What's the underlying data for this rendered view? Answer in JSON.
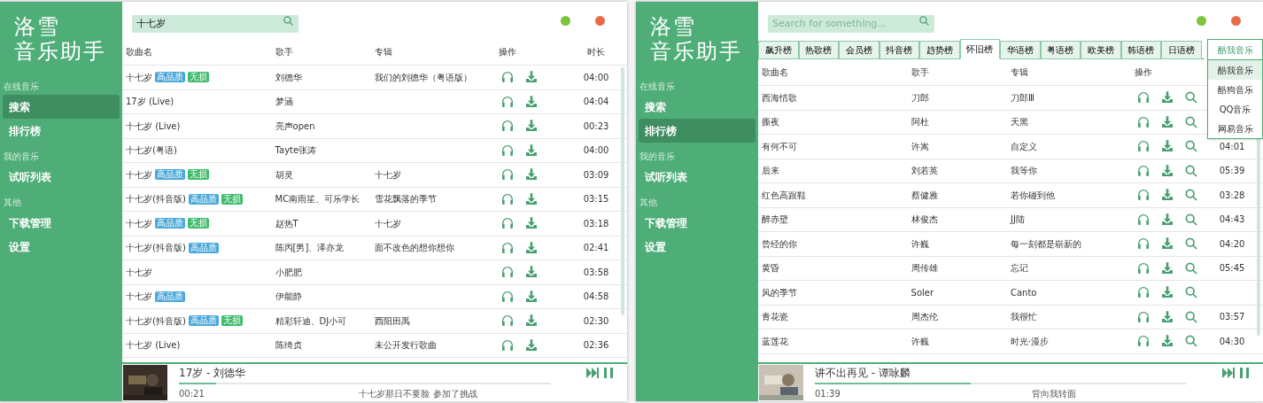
{
  "windows": [
    {
      "logo": [
        "洛雪",
        "音乐助手"
      ],
      "sidebar": [
        {
          "label": "在线音乐",
          "items": [
            {
              "label": "搜索",
              "selected": true
            },
            {
              "label": "排行榜",
              "selected": false
            }
          ]
        },
        {
          "label": "我的音乐",
          "items": [
            {
              "label": "试听列表",
              "selected": false
            }
          ]
        },
        {
          "label": "其他",
          "items": [
            {
              "label": "下载管理",
              "selected": false
            },
            {
              "label": "设置",
              "selected": false
            }
          ]
        }
      ],
      "search": {
        "value": "十七岁"
      },
      "columns": [
        "歌曲名",
        "歌手",
        "专辑",
        "操作",
        "时长"
      ],
      "actions": [
        {
          "kind": "listen"
        },
        {
          "kind": "download"
        }
      ],
      "rows": [
        {
          "song": "十七岁",
          "badges": [
            {
              "kind": "hq",
              "label": "高品质"
            },
            {
              "kind": "lossless",
              "label": "无损"
            }
          ],
          "singer": "刘德华",
          "album": "我们的刘德华（粤语版）",
          "duration": "04:00"
        },
        {
          "song": "17岁 (Live)",
          "singer": "梦涵",
          "duration": "04:04"
        },
        {
          "song": "十七岁 (Live)",
          "singer": "亮声open",
          "duration": "00:23"
        },
        {
          "song": "十七岁(粤语)",
          "singer": "Tayte张涛",
          "duration": "04:00"
        },
        {
          "song": "十七岁",
          "badges": [
            {
              "kind": "hq",
              "label": "高品质"
            },
            {
              "kind": "lossless",
              "label": "无损"
            }
          ],
          "singer": "胡灵",
          "album": "十七岁",
          "duration": "03:09"
        },
        {
          "song": "十七岁(抖音版)",
          "badges": [
            {
              "kind": "hq",
              "label": "高品质"
            },
            {
              "kind": "lossless",
              "label": "无损"
            }
          ],
          "singer": "MC南雨笙、可乐学长",
          "album": "雪花飘落的季节",
          "duration": "03:15"
        },
        {
          "song": "十七岁",
          "badges": [
            {
              "kind": "hq",
              "label": "高品质"
            },
            {
              "kind": "lossless",
              "label": "无损"
            }
          ],
          "singer": "赵热T",
          "album": "十七岁",
          "duration": "03:18"
        },
        {
          "song": "十七岁(抖音版)",
          "badges": [
            {
              "kind": "hq",
              "label": "高品质"
            }
          ],
          "singer": "陈丙[男]、泽亦龙",
          "album": "面不改色的想你想你",
          "duration": "02:41"
        },
        {
          "song": "十七岁",
          "singer": "小肥肥",
          "duration": "03:58"
        },
        {
          "song": "十七岁",
          "badges": [
            {
              "kind": "hq",
              "label": "高品质"
            }
          ],
          "singer": "伊能静",
          "duration": "04:58"
        },
        {
          "song": "十七岁(抖音版)",
          "badges": [
            {
              "kind": "hq",
              "label": "高品质"
            },
            {
              "kind": "lossless",
              "label": "无损"
            }
          ],
          "singer": "精彩轩迪、DJ小可",
          "album": "酉阳田禹",
          "duration": "02:30"
        },
        {
          "song": "十七岁 (Live)",
          "singer": "陈绮贞",
          "album": "未公开发行歌曲",
          "duration": "02:36"
        }
      ],
      "player": {
        "title": "17岁 - 刘德华",
        "time": "00:21",
        "lyric": "十七岁那日不要脸 参加了挑战",
        "level": 0.1
      }
    },
    {
      "logo": [
        "洛雪",
        "音乐助手"
      ],
      "sidebar": [
        {
          "label": "在线音乐",
          "items": [
            {
              "label": "搜索",
              "selected": false
            },
            {
              "label": "排行榜",
              "selected": true
            }
          ]
        },
        {
          "label": "我的音乐",
          "items": [
            {
              "label": "试听列表",
              "selected": false
            }
          ]
        },
        {
          "label": "其他",
          "items": [
            {
              "label": "下载管理",
              "selected": false
            },
            {
              "label": "设置",
              "selected": false
            }
          ]
        }
      ],
      "search": {
        "placeholder": "Search for something..."
      },
      "tabs": [
        {
          "label": "飙升榜",
          "selected": false
        },
        {
          "label": "热歌榜",
          "selected": false
        },
        {
          "label": "会员榜",
          "selected": false
        },
        {
          "label": "抖音榜",
          "selected": false
        },
        {
          "label": "趋势榜",
          "selected": false
        },
        {
          "label": "怀旧榜",
          "selected": true
        },
        {
          "label": "华语榜",
          "selected": false
        },
        {
          "label": "粤语榜",
          "selected": false
        },
        {
          "label": "欧美榜",
          "selected": false
        },
        {
          "label": "韩语榜",
          "selected": false
        },
        {
          "label": "日语榜",
          "selected": false
        }
      ],
      "source_menu": {
        "value": "酷我音乐",
        "options": [
          {
            "label": "酷我音乐",
            "selected": true
          },
          {
            "label": "酷狗音乐",
            "selected": false
          },
          {
            "label": "QQ音乐",
            "selected": false
          },
          {
            "label": "网易音乐",
            "selected": false
          }
        ]
      },
      "columns": [
        "歌曲名",
        "歌手",
        "专辑",
        "操作"
      ],
      "actions": [
        {
          "kind": "listen"
        },
        {
          "kind": "download"
        },
        {
          "kind": "search"
        }
      ],
      "rows": [
        {
          "song": "西海情歌",
          "singer": "刀郎",
          "album": "刀郎Ⅲ"
        },
        {
          "song": "撕夜",
          "singer": "阿杜",
          "album": "天黑"
        },
        {
          "song": "有何不可",
          "singer": "许嵩",
          "album": "自定义",
          "duration": "04:01"
        },
        {
          "song": "后来",
          "singer": "刘若英",
          "album": "我等你",
          "duration": "05:39"
        },
        {
          "song": "红色高跟鞋",
          "singer": "蔡健雅",
          "album": "若你碰到他",
          "duration": "03:28"
        },
        {
          "song": "醉赤壁",
          "singer": "林俊杰",
          "album": "JJ陆",
          "duration": "04:43"
        },
        {
          "song": "曾经的你",
          "singer": "许巍",
          "album": "每一刻都是崭新的",
          "duration": "04:20"
        },
        {
          "song": "黄昏",
          "singer": "周传雄",
          "album": "忘记",
          "duration": "05:45"
        },
        {
          "song": "风的季节",
          "singer": "Soler",
          "album": "Canto"
        },
        {
          "song": "青花瓷",
          "singer": "周杰伦",
          "album": "我很忙",
          "duration": "03:57"
        },
        {
          "song": "蓝莲花",
          "singer": "许巍",
          "album": "时光·漫步",
          "duration": "04:30"
        }
      ],
      "player": {
        "title": "讲不出再见 - 谭咏麟",
        "time": "01:39",
        "lyric": "背向我转面",
        "level": 0.42
      }
    }
  ]
}
